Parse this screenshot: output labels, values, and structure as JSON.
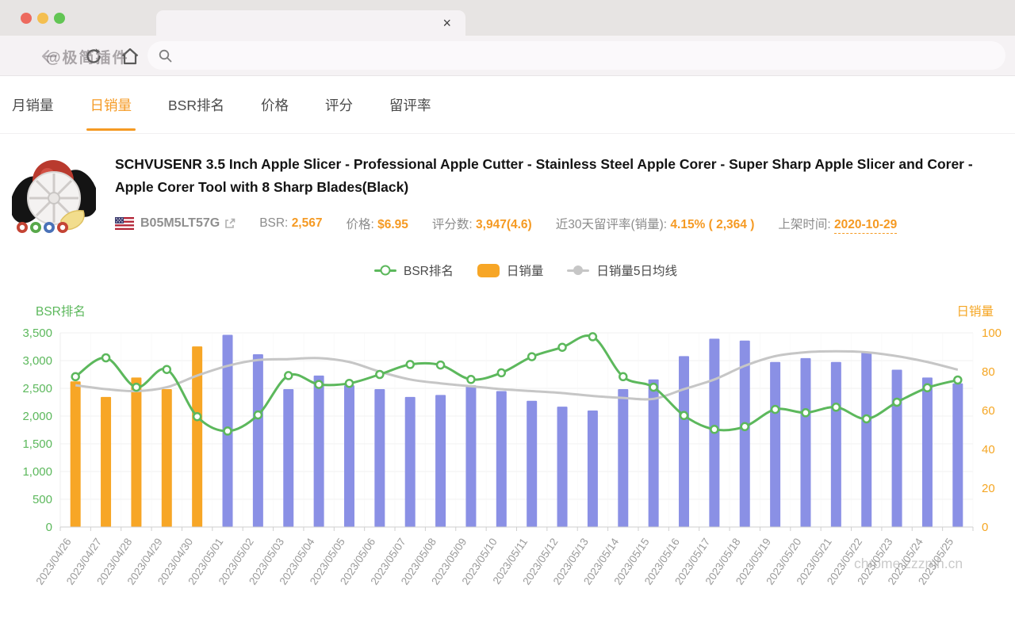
{
  "browser": {
    "close_tab_icon": "×",
    "watermark": "@极简插件"
  },
  "nav_tabs": [
    {
      "label": "月销量"
    },
    {
      "label": "日销量"
    },
    {
      "label": "BSR排名"
    },
    {
      "label": "价格"
    },
    {
      "label": "评分"
    },
    {
      "label": "留评率"
    }
  ],
  "product": {
    "title": "SCHVUSENR 3.5 Inch Apple Slicer - Professional Apple Cutter - Stainless Steel Apple Corer - Super Sharp Apple Slicer and Corer - Apple Corer Tool with 8 Sharp Blades(Black)",
    "asin": "B05M5LT57G",
    "stats": [
      {
        "label": "BSR:",
        "value": "2,567"
      },
      {
        "label": "价格:",
        "value": "$6.95"
      },
      {
        "label": "评分数:",
        "value": "3,947(4.6)"
      },
      {
        "label": "近30天留评率(销量):",
        "value": "4.15% ( 2,364 )"
      },
      {
        "label": "上架时间:",
        "value": "2020-10-29"
      }
    ]
  },
  "colors": {
    "accent_orange": "#f59a23",
    "bar_purple": "#8a90e5",
    "bar_orange": "#f7a626",
    "line_green": "#5cb85c",
    "ma_gray": "#c6c6c6"
  },
  "chart_data": {
    "type": "bar",
    "subtype": "bar+line combo, dual axis",
    "categories": [
      "2023/04/26",
      "2023/04/27",
      "2023/04/28",
      "2023/04/29",
      "2023/04/30",
      "2023/05/01",
      "2023/05/02",
      "2023/05/03",
      "2023/05/04",
      "2023/05/05",
      "2023/05/06",
      "2023/05/07",
      "2023/05/08",
      "2023/05/09",
      "2023/05/10",
      "2023/05/11",
      "2023/05/12",
      "2023/05/13",
      "2023/05/14",
      "2023/05/15",
      "2023/05/16",
      "2023/05/17",
      "2023/05/18",
      "2023/05/19",
      "2023/05/20",
      "2023/05/21",
      "2023/05/22",
      "2023/05/23",
      "2023/05/24",
      "2023/05/25"
    ],
    "series": [
      {
        "name": "BSR排名",
        "type": "line",
        "axis": "left",
        "color": "#5cb85c",
        "marker": "hollow-circle",
        "values": [
          2710,
          3050,
          2520,
          2840,
          1990,
          1730,
          2020,
          2730,
          2570,
          2590,
          2750,
          2930,
          2920,
          2660,
          2780,
          3070,
          3240,
          3430,
          2710,
          2520,
          2010,
          1760,
          1810,
          2120,
          2060,
          2160,
          1950,
          2250,
          2510,
          2650
        ]
      },
      {
        "name": "日销量",
        "type": "bar",
        "axis": "right",
        "color": "#8a90e5",
        "highlight_color": "#f7a626",
        "highlight_count": 5,
        "values": [
          75,
          67,
          77,
          71,
          93,
          99,
          89,
          71,
          78,
          73,
          71,
          67,
          68,
          73,
          70,
          65,
          62,
          60,
          71,
          76,
          88,
          97,
          96,
          85,
          87,
          85,
          90,
          81,
          77,
          74
        ]
      },
      {
        "name": "日销量5日均线",
        "type": "line",
        "axis": "right",
        "color": "#c6c6c6",
        "marker": "solid-circle",
        "values": [
          73,
          71,
          70,
          72,
          78,
          83,
          86,
          86.5,
          87,
          85,
          80,
          76,
          74,
          72.5,
          71,
          70,
          69,
          67.5,
          66.5,
          66,
          71,
          76,
          83,
          88,
          90,
          90.5,
          90,
          88,
          85,
          81
        ]
      }
    ],
    "left_axis": {
      "title": "BSR排名",
      "color": "#5cb85c",
      "min": 0,
      "max": 3500,
      "tick_step": 500,
      "tick_labels": [
        "0",
        "500",
        "1,000",
        "1,500",
        "2,000",
        "2,500",
        "3,000",
        "3,500"
      ]
    },
    "right_axis": {
      "title": "日销量",
      "color": "#f5a623",
      "min": 0,
      "max": 100,
      "tick_step": 20,
      "tick_labels": [
        "0",
        "20",
        "40",
        "60",
        "80",
        "100"
      ]
    },
    "grid": true,
    "legend_position": "top-center"
  },
  "site_watermark": "chrome.zzzmh.cn"
}
